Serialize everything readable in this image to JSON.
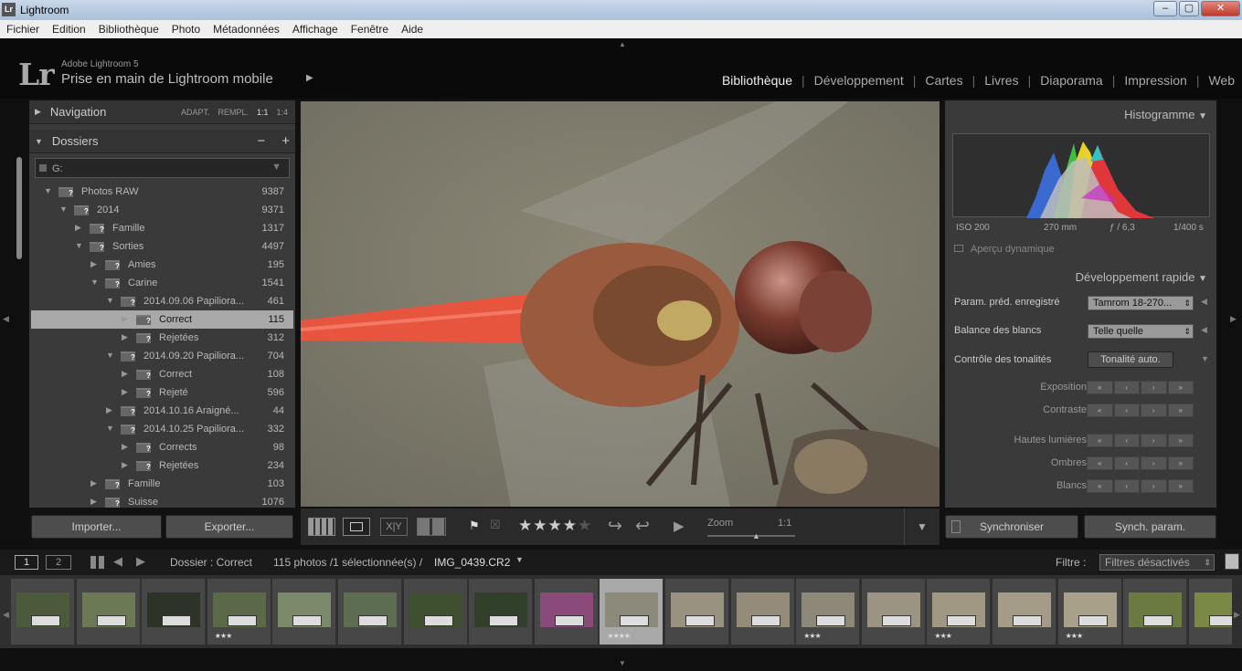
{
  "window": {
    "title": "Lightroom",
    "logo": "Lr"
  },
  "menu": [
    "Fichier",
    "Edition",
    "Bibliothèque",
    "Photo",
    "Métadonnées",
    "Affichage",
    "Fenêtre",
    "Aide"
  ],
  "identity": {
    "logo": "Lr",
    "version": "Adobe Lightroom 5",
    "catalog": "Prise en main de Lightroom mobile"
  },
  "modules": [
    "Bibliothèque",
    "Développement",
    "Cartes",
    "Livres",
    "Diaporama",
    "Impression",
    "Web"
  ],
  "navigator": {
    "label": "Navigation",
    "opts": [
      "ADAPT.",
      "REMPL.",
      "1:1",
      "1:4"
    ]
  },
  "folders": {
    "label": "Dossiers",
    "volume": "G:",
    "rows": [
      {
        "name": "Photos RAW",
        "count": "9387",
        "indent": 0,
        "arrow": "▼"
      },
      {
        "name": "2014",
        "count": "9371",
        "indent": 1,
        "arrow": "▼"
      },
      {
        "name": "Famille",
        "count": "1317",
        "indent": 2,
        "arrow": "▶"
      },
      {
        "name": "Sorties",
        "count": "4497",
        "indent": 2,
        "arrow": "▼"
      },
      {
        "name": "Amies",
        "count": "195",
        "indent": 3,
        "arrow": "▶"
      },
      {
        "name": "Carine",
        "count": "1541",
        "indent": 3,
        "arrow": "▼"
      },
      {
        "name": "2014.09.06 Papiliora...",
        "count": "461",
        "indent": 4,
        "arrow": "▼"
      },
      {
        "name": "Correct",
        "count": "115",
        "indent": 5,
        "arrow": "▶",
        "selected": true
      },
      {
        "name": "Rejetées",
        "count": "312",
        "indent": 5,
        "arrow": "▶"
      },
      {
        "name": "2014.09.20 Papiliora...",
        "count": "704",
        "indent": 4,
        "arrow": "▼"
      },
      {
        "name": "Correct",
        "count": "108",
        "indent": 5,
        "arrow": "▶"
      },
      {
        "name": "Rejeté",
        "count": "596",
        "indent": 5,
        "arrow": "▶"
      },
      {
        "name": "2014.10.16 Araigné...",
        "count": "44",
        "indent": 4,
        "arrow": "▶"
      },
      {
        "name": "2014.10.25 Papiliora...",
        "count": "332",
        "indent": 4,
        "arrow": "▼"
      },
      {
        "name": "Corrects",
        "count": "98",
        "indent": 5,
        "arrow": "▶"
      },
      {
        "name": "Rejetées",
        "count": "234",
        "indent": 5,
        "arrow": "▶"
      },
      {
        "name": "Famille",
        "count": "103",
        "indent": 3,
        "arrow": "▶"
      },
      {
        "name": "Suisse",
        "count": "1076",
        "indent": 3,
        "arrow": "▶"
      }
    ]
  },
  "import_label": "Importer...",
  "export_label": "Exporter...",
  "histogram": {
    "label": "Histogramme",
    "iso": "ISO 200",
    "focal": "270 mm",
    "aperture": "ƒ / 6,3",
    "shutter": "1/400 s",
    "preview": "Aperçu dynamique"
  },
  "quick_develop": {
    "label": "Développement rapide",
    "preset_label": "Param. préd. enregistré",
    "preset_value": "Tamrom 18-270...",
    "wb_label": "Balance des blancs",
    "wb_value": "Telle quelle",
    "tone_label": "Contrôle des tonalités",
    "auto_tone": "Tonalité auto.",
    "sliders": [
      "Exposition",
      "Contraste",
      "Hautes lumières",
      "Ombres",
      "Blancs"
    ]
  },
  "sync_label": "Synchroniser",
  "sync_settings_label": "Synch. param.",
  "toolbar": {
    "zoom_label": "Zoom",
    "zoom_value": "1:1",
    "rating": 4
  },
  "filmbar": {
    "screen1": "1",
    "screen2": "2",
    "source": "Dossier : Correct",
    "summary": "115 photos /1 sélectionnée(s) /",
    "filename": "IMG_0439.CR2",
    "filter_label": "Filtre :",
    "filter_value": "Filtres désactivés"
  },
  "filmstrip": [
    {
      "color": "#4a5a3a",
      "stars": ""
    },
    {
      "color": "#6b7a55",
      "stars": ""
    },
    {
      "color": "#2d3326",
      "stars": ""
    },
    {
      "color": "#5a6a48",
      "stars": "★★★"
    },
    {
      "color": "#7a8a6a",
      "stars": ""
    },
    {
      "color": "#5c6d52",
      "stars": ""
    },
    {
      "color": "#3e5030",
      "stars": ""
    },
    {
      "color": "#30402a",
      "stars": ""
    },
    {
      "color": "#8a4a7a",
      "stars": ""
    },
    {
      "color": "#8c8a7a",
      "stars": "★★★★",
      "selected": true
    },
    {
      "color": "#9a9280",
      "stars": ""
    },
    {
      "color": "#948c78",
      "stars": ""
    },
    {
      "color": "#8e8878",
      "stars": "★★★"
    },
    {
      "color": "#9c9482",
      "stars": ""
    },
    {
      "color": "#a09882",
      "stars": "★★★"
    },
    {
      "color": "#a49c86",
      "stars": ""
    },
    {
      "color": "#a8a088",
      "stars": "★★★"
    },
    {
      "color": "#6a7a40",
      "stars": ""
    },
    {
      "color": "#7a8a44",
      "stars": ""
    }
  ]
}
